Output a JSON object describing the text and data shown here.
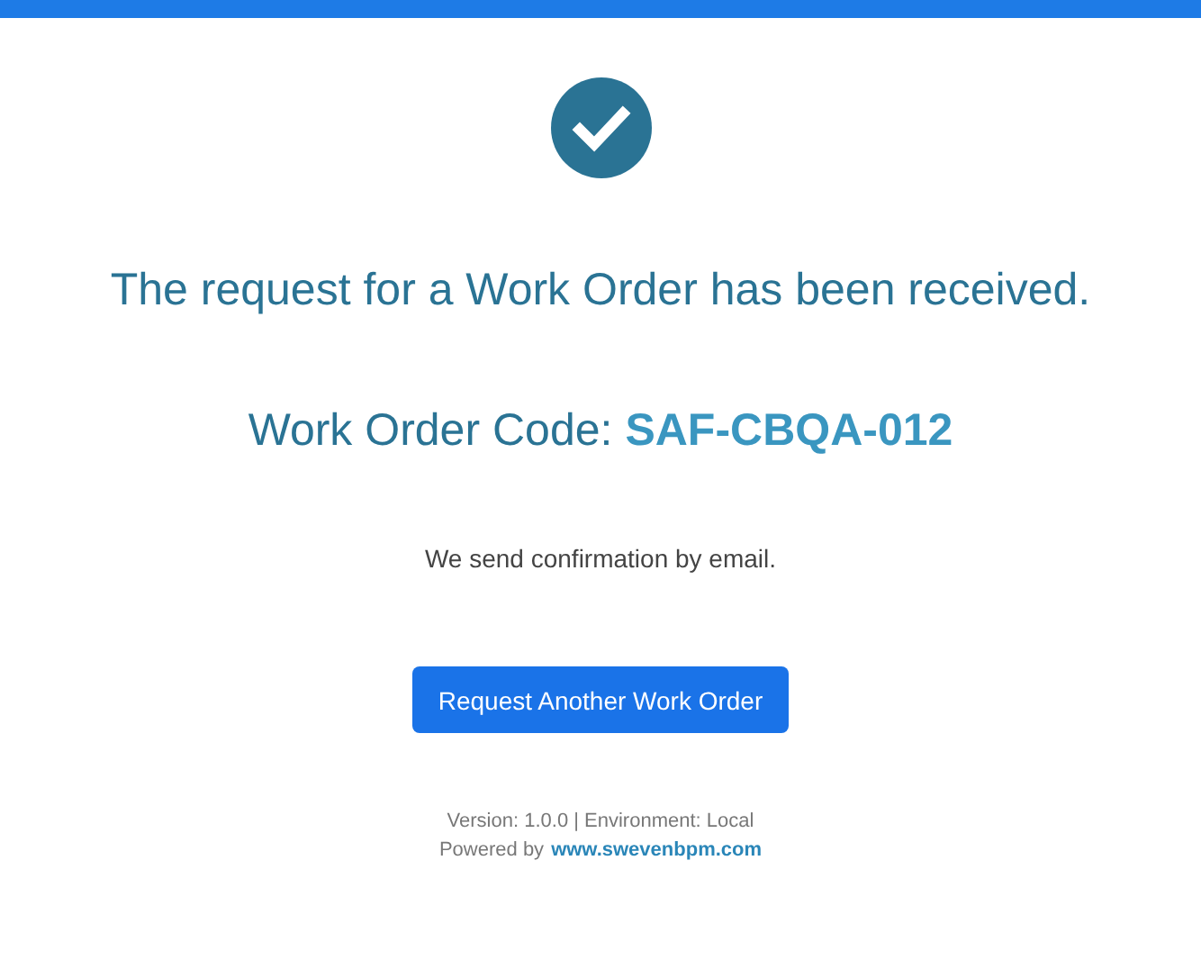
{
  "headline": "The request for a Work Order has been received.",
  "code": {
    "label": "Work Order Code:",
    "value": "SAF-CBQA-012"
  },
  "message": "We send confirmation by email.",
  "button": "Request Another Work Order",
  "footer": {
    "version": "Version: 1.0.0 | Environment: Local",
    "powered_by": "Powered by",
    "link": "www.swevenbpm.com"
  }
}
